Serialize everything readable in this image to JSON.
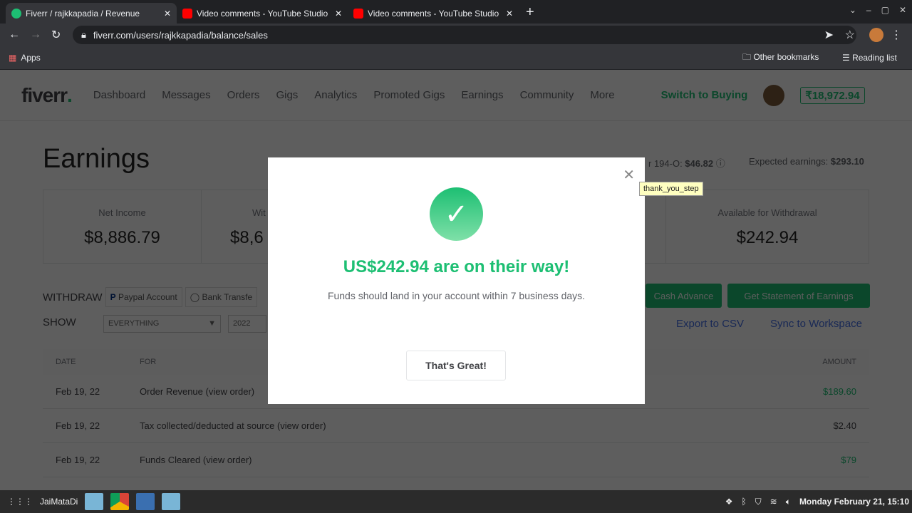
{
  "browser": {
    "tabs": [
      {
        "title": "Fiverr / rajkkapadia / Revenue",
        "active": true,
        "icon": "fiverr-icon"
      },
      {
        "title": "Video comments - YouTube Studio",
        "icon": "youtube-icon"
      },
      {
        "title": "Video comments - YouTube Studio",
        "icon": "youtube-icon"
      }
    ],
    "url": "fiverr.com/users/rajkkapadia/balance/sales",
    "bookmarks": {
      "apps": "Apps",
      "other": "Other bookmarks",
      "reading": "Reading list"
    }
  },
  "nav": {
    "logo": "fiverr",
    "items": [
      "Dashboard",
      "Messages",
      "Orders",
      "Gigs",
      "Analytics",
      "Promoted Gigs",
      "Earnings",
      "Community",
      "More"
    ],
    "switch": "Switch to Buying",
    "balance": "₹18,972.94"
  },
  "page": {
    "title": "Earnings",
    "tds": "r 194-O: ",
    "tds_value": "$46.82",
    "expected_label": "Expected earnings: ",
    "expected_value": "$293.10",
    "cards": [
      {
        "label": "Net Income",
        "value": "$8,886.79"
      },
      {
        "label": "Wit",
        "value": "$8,6"
      },
      {
        "label": "",
        "value": ""
      },
      {
        "label": "Available for Withdrawal",
        "value": "$242.94"
      }
    ],
    "withdraw_label": "WITHDRAW",
    "paypal": "Paypal Account",
    "bank": "Bank Transfe",
    "cash_advance": "Cash Advance",
    "statement": "Get Statement of Earnings",
    "show_label": "SHOW",
    "filter": "EVERYTHING",
    "year": "2022",
    "export": "Export to CSV",
    "sync": "Sync to Workspace",
    "table": {
      "headers": [
        "DATE",
        "FOR",
        "AMOUNT"
      ],
      "rows": [
        {
          "date": "Feb 19, 22",
          "for": "Order Revenue (view order)",
          "amount": "$189.60",
          "green": true
        },
        {
          "date": "Feb 19, 22",
          "for": "Tax collected/deducted at source (view order)",
          "amount": "$2.40",
          "green": false
        },
        {
          "date": "Feb 19, 22",
          "for": "Funds Cleared (view order)",
          "amount": "$79",
          "green": true
        }
      ]
    }
  },
  "modal": {
    "title": "US$242.94 are on their way!",
    "subtitle": "Funds should land in your account within 7 business days.",
    "button": "That's Great!",
    "tooltip": "thank_you_step"
  },
  "taskbar": {
    "user": "JaiMataDi",
    "clock": "Monday February 21, 15:10"
  },
  "colors": {
    "brand": "#1dbf73",
    "link": "#446ee7"
  }
}
